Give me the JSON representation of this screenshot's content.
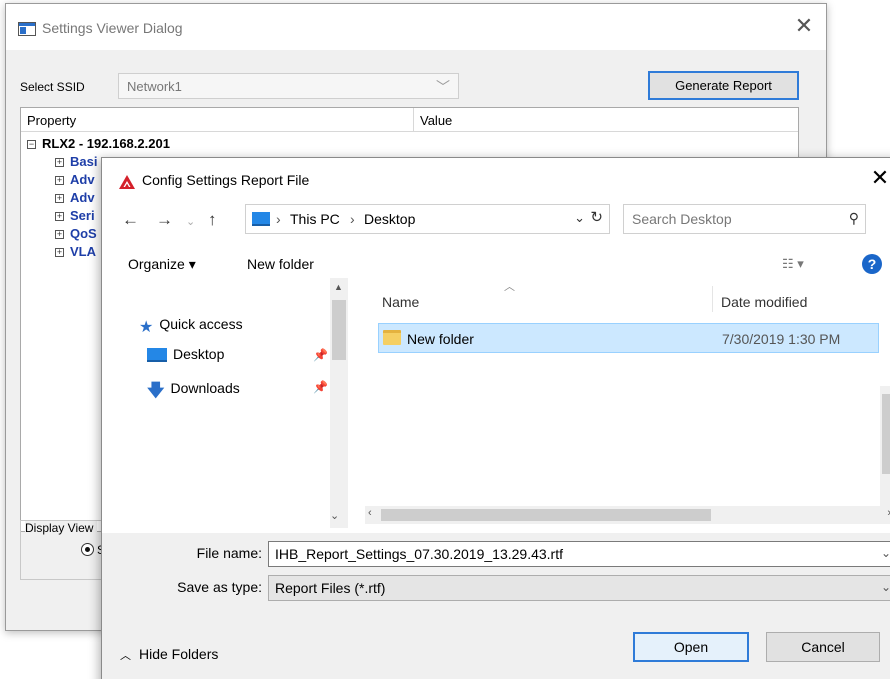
{
  "settings_dialog": {
    "title": "Settings Viewer Dialog",
    "select_ssid_label": "Select SSID",
    "ssid_value": "Network1",
    "generate_report_label": "Generate Report",
    "columns": {
      "property": "Property",
      "value": "Value"
    },
    "root_node": "RLX2  - 192.168.2.201",
    "children": [
      "Basi",
      "Adv",
      "Adv",
      "Seri",
      "QoS",
      "VLA"
    ],
    "display_view_label": "Display View",
    "radio_label": "S"
  },
  "save_dialog": {
    "title": "Config Settings Report File",
    "breadcrumb": [
      "This PC",
      "Desktop"
    ],
    "search_placeholder": "Search Desktop",
    "organize_label": "Organize ▾",
    "new_folder_label": "New folder",
    "nav_pane": {
      "quick_access": "Quick access",
      "desktop": "Desktop",
      "downloads": "Downloads"
    },
    "file_list": {
      "columns": {
        "name": "Name",
        "date_modified": "Date modified"
      },
      "rows": [
        {
          "name": "New folder",
          "date": "7/30/2019 1:30 PM"
        }
      ]
    },
    "file_name_label": "File name:",
    "file_name_value": "IHB_Report_Settings_07.30.2019_13.29.43.rtf",
    "save_as_type_label": "Save as type:",
    "save_as_type_value": "Report Files (*.rtf)",
    "hide_folders_label": "Hide Folders",
    "open_label": "Open",
    "cancel_label": "Cancel"
  },
  "colors": {
    "accent": "#2f7bd8",
    "tree_child": "#1e3ea8",
    "selection": "#cce8ff",
    "help": "#1a66c9"
  }
}
